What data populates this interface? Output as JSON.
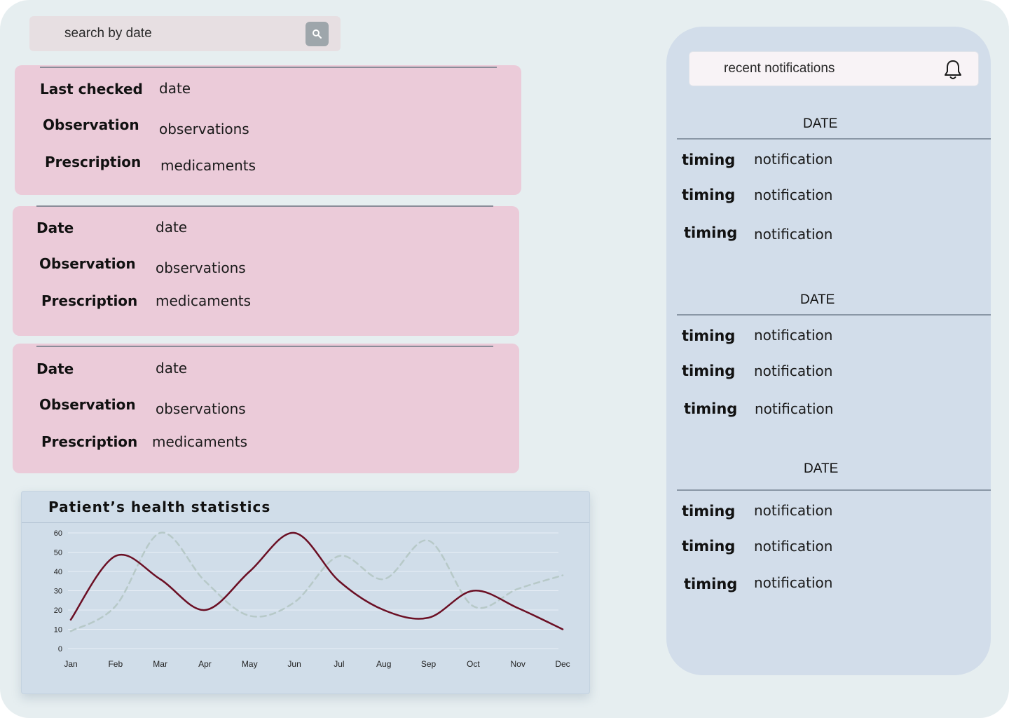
{
  "search": {
    "placeholder": "search  by date"
  },
  "records": [
    {
      "date_label": "Last checked",
      "date_value": "date",
      "observation_label": "Observation",
      "observation_value": "observations",
      "prescription_label": "Prescription",
      "prescription_value": "medicaments"
    },
    {
      "date_label": "Date",
      "date_value": "date",
      "observation_label": "Observation",
      "observation_value": "observations",
      "prescription_label": "Prescription",
      "prescription_value": "medicaments"
    },
    {
      "date_label": "Date",
      "date_value": "date",
      "observation_label": "Observation",
      "observation_value": "observations",
      "prescription_label": "Prescription",
      "prescription_value": "medicaments"
    }
  ],
  "chart_data": {
    "type": "line",
    "title": "Patient’s health statistics",
    "categories": [
      "Jan",
      "Feb",
      "Mar",
      "Apr",
      "May",
      "Jun",
      "Jul",
      "Aug",
      "Sep",
      "Oct",
      "Nov",
      "Dec"
    ],
    "yticks": [
      0,
      10,
      20,
      30,
      40,
      50,
      60
    ],
    "ylim": [
      0,
      60
    ],
    "grid": true,
    "series": [
      {
        "values": [
          15,
          48,
          36,
          20,
          40,
          60,
          35,
          20,
          16,
          30,
          21,
          10
        ],
        "color": "#6b0f24",
        "style": "solid"
      },
      {
        "values": [
          9,
          22,
          60,
          35,
          17,
          24,
          48,
          36,
          56,
          22,
          31,
          38
        ],
        "color": "#b7c9c8",
        "style": "dashed"
      }
    ]
  },
  "notifications": {
    "header": "recent notifications",
    "icon": "bell-icon",
    "groups": [
      {
        "date": "DATE",
        "items": [
          {
            "timing": "timing",
            "text": "notification"
          },
          {
            "timing": "timing",
            "text": "notification"
          },
          {
            "timing": "timing",
            "text": "notification"
          }
        ]
      },
      {
        "date": "DATE",
        "items": [
          {
            "timing": "timing",
            "text": "notification"
          },
          {
            "timing": "timing",
            "text": "notification"
          },
          {
            "timing": "timing",
            "text": "notification"
          }
        ]
      },
      {
        "date": "DATE",
        "items": [
          {
            "timing": "timing",
            "text": "notification"
          },
          {
            "timing": "timing",
            "text": "notification"
          },
          {
            "timing": "timing",
            "text": "notification"
          }
        ]
      }
    ]
  }
}
